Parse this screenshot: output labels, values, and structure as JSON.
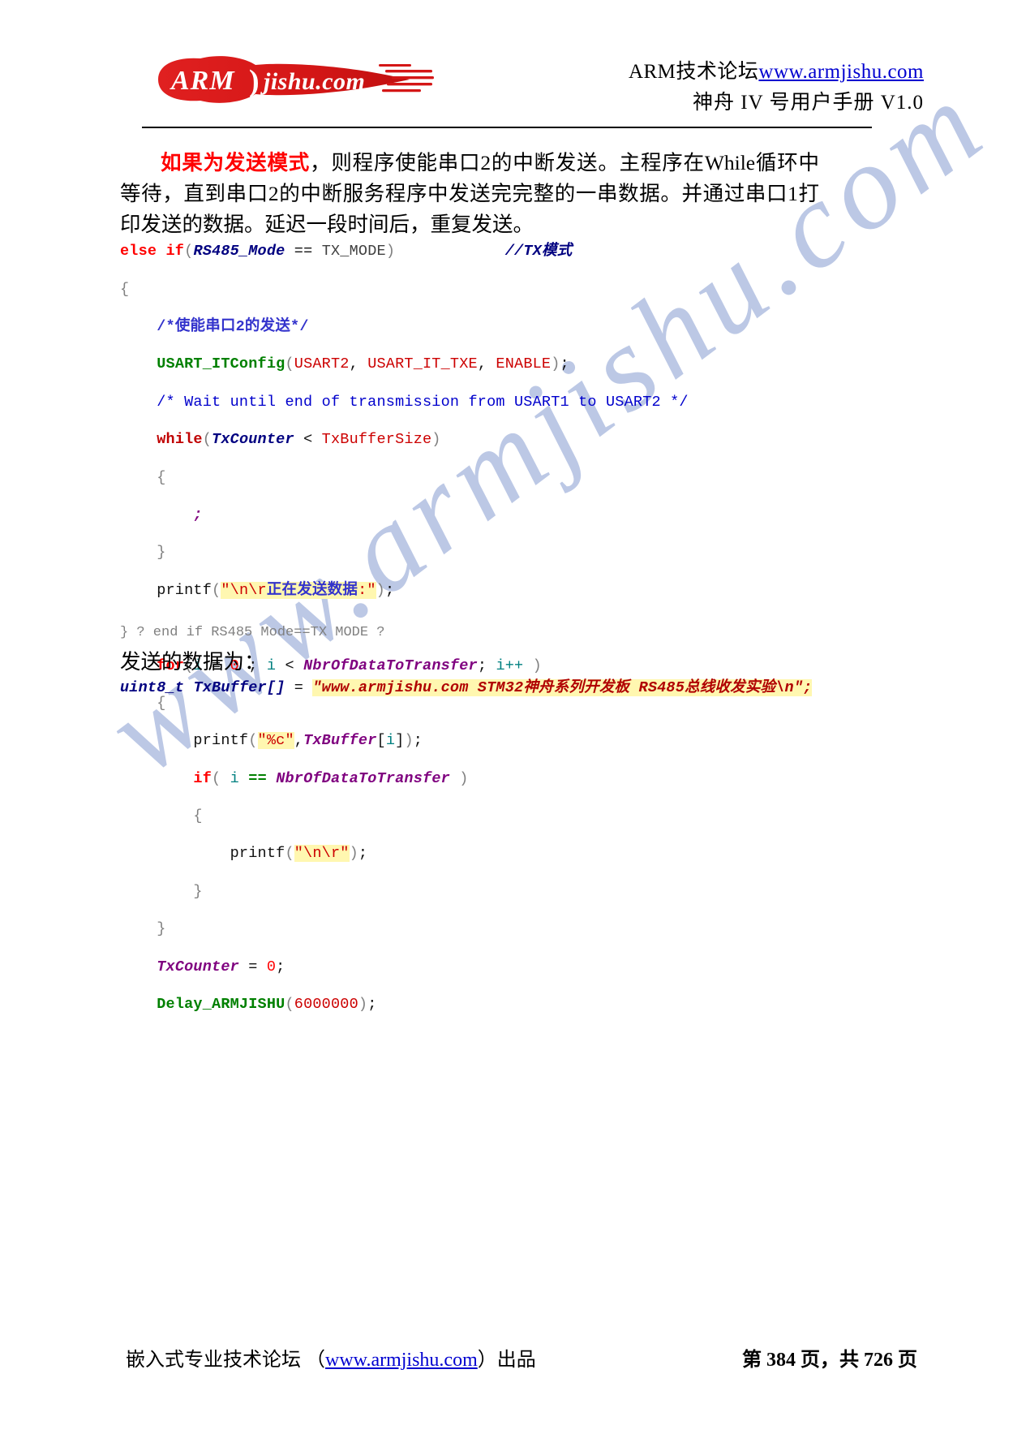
{
  "header": {
    "logo_alt": "ARM)jishu.com",
    "logo_text_main": "ARM",
    "logo_text_sub": "jishu.com",
    "line1_prefix": "ARM技术论坛",
    "line1_link": "www.armjishu.com",
    "line2": "神舟 IV 号用户手册 V1.0"
  },
  "paragraph": {
    "highlight": "如果为发送模式",
    "rest": "，则程序使能串口2的中断发送。主程序在While循环中等待，直到串口2的中断服务程序中发送完完整的一串数据。并通过串口1打印发送的数据。延迟一段时间后，重复发送。"
  },
  "code": {
    "lines": [
      "else if(RS485_Mode == TX_MODE)            //TX模式",
      "{",
      "    /*使能串口2的发送*/",
      "    USART_ITConfig(USART2, USART_IT_TXE, ENABLE);",
      "    /* Wait until end of transmission from USART1 to USART2 */",
      "    while(TxCounter < TxBufferSize)",
      "    {",
      "        ;",
      "    }",
      "    printf(\"\\n\\r正在发送数据:\");",
      "",
      "    for(i = 0 ; i < NbrOfDataToTransfer; i++ )",
      "    {",
      "        printf(\"%c\",TxBuffer[i]);",
      "        if( i == NbrOfDataToTransfer )",
      "        {",
      "            printf(\"\\n\\r\");",
      "        }",
      "    }",
      "    TxCounter = 0;",
      "    Delay_ARMJISHU(6000000);",
      ""
    ],
    "end_comment": "} ? end if RS485 Mode==TX MODE ?"
  },
  "send_label": "发送的数据为：",
  "declaration": {
    "type": "uint8_t",
    "name": "TxBuffer[]",
    "assign": " = ",
    "value": "\"www.armjishu.com STM32神舟系列开发板 RS485总线收发实验\\n\";"
  },
  "watermark": {
    "text": "www.armjishu.com"
  },
  "footer": {
    "left_prefix": "嵌入式专业技术论坛 （",
    "left_link": "www.armjishu.com",
    "left_suffix": "）出品",
    "right": "第 384 页，共 726 页"
  },
  "colors": {
    "logo_red": "#d81f1f",
    "link_blue": "#0000d0",
    "highlight_red": "#ff0000",
    "code_string_hl": "#fff7b0",
    "watermark_blue": "#b9c6e4"
  }
}
